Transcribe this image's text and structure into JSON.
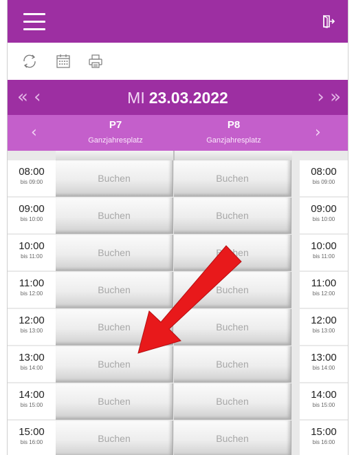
{
  "header": {
    "menu_icon": "hamburger-menu-icon",
    "logout_icon": "logout-door-icon"
  },
  "toolbar": {
    "icons": [
      "refresh-icon",
      "calendar-icon",
      "print-icon"
    ]
  },
  "datebar": {
    "weekday": "MI",
    "date": "23.03.2022",
    "prev": "«  ‹",
    "next": "›  »"
  },
  "places": [
    {
      "name": "P7",
      "subtitle": "Ganzjahresplatz"
    },
    {
      "name": "P8",
      "subtitle": "Ganzjahresplatz"
    }
  ],
  "slots": [
    {
      "time": "08:00",
      "until": "bis 09:00",
      "cells": [
        "Buchen",
        "Buchen"
      ]
    },
    {
      "time": "09:00",
      "until": "bis 10:00",
      "cells": [
        "Buchen",
        "Buchen"
      ]
    },
    {
      "time": "10:00",
      "until": "bis 11:00",
      "cells": [
        "Buchen",
        "Buchen"
      ]
    },
    {
      "time": "11:00",
      "until": "bis 12:00",
      "cells": [
        "Buchen",
        "Buchen"
      ]
    },
    {
      "time": "12:00",
      "until": "bis 13:00",
      "cells": [
        "Buchen",
        "Buchen"
      ]
    },
    {
      "time": "13:00",
      "until": "bis 14:00",
      "cells": [
        "Buchen",
        "Buchen"
      ]
    },
    {
      "time": "14:00",
      "until": "bis 15:00",
      "cells": [
        "Buchen",
        "Buchen"
      ]
    },
    {
      "time": "15:00",
      "until": "bis 16:00",
      "cells": [
        "Buchen",
        "Buchen"
      ]
    }
  ],
  "colors": {
    "primary": "#9d2fa2",
    "secondary": "#c45fcb",
    "annotation": "#e8191b"
  }
}
